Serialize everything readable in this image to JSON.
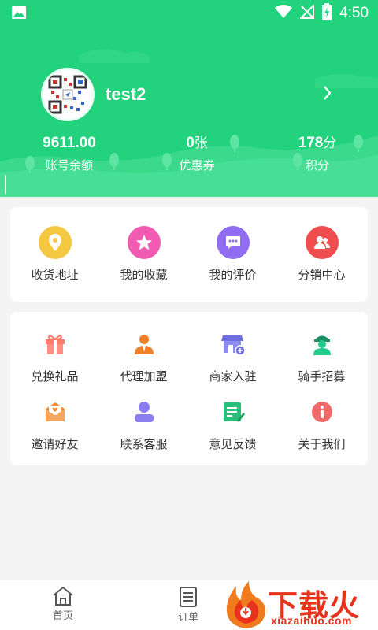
{
  "status_bar": {
    "time": "4:50"
  },
  "profile": {
    "username": "test2"
  },
  "stats": [
    {
      "value": "9611.00",
      "unit": "",
      "label": "账号余额"
    },
    {
      "value": "0",
      "unit": "张",
      "label": "优惠券"
    },
    {
      "value": "178",
      "unit": "分",
      "label": "积分"
    }
  ],
  "quick_menu": [
    {
      "label": "收货地址",
      "icon": "location-pin-icon",
      "color": "#f5c842"
    },
    {
      "label": "我的收藏",
      "icon": "star-icon",
      "color": "#f25bb2"
    },
    {
      "label": "我的评价",
      "icon": "chat-bubble-icon",
      "color": "#8f6cf0"
    },
    {
      "label": "分销中心",
      "icon": "people-icon",
      "color": "#f04e4e"
    }
  ],
  "services": [
    {
      "label": "兑换礼品",
      "icon": "gift-icon",
      "color": "#ff7a6b"
    },
    {
      "label": "代理加盟",
      "icon": "agent-icon",
      "color": "#f0802a"
    },
    {
      "label": "商家入驻",
      "icon": "store-icon",
      "color": "#6f6fe0"
    },
    {
      "label": "骑手招募",
      "icon": "rider-icon",
      "color": "#21c98a"
    },
    {
      "label": "邀请好友",
      "icon": "envelope-icon",
      "color": "#f58a2e"
    },
    {
      "label": "联系客服",
      "icon": "contact-icon",
      "color": "#8a7df0"
    },
    {
      "label": "意见反馈",
      "icon": "feedback-icon",
      "color": "#26c07a"
    },
    {
      "label": "关于我们",
      "icon": "info-icon",
      "color": "#f06a6a"
    }
  ],
  "bottom_nav": [
    {
      "label": "首页",
      "icon": "home-icon"
    },
    {
      "label": "订单",
      "icon": "orders-icon"
    }
  ],
  "watermark": {
    "text": "下载火",
    "url": "xiazaihuo.com"
  },
  "colors": {
    "brand_green": "#22d27d",
    "text_dark": "#333333",
    "watermark_red": "#e7321c"
  }
}
